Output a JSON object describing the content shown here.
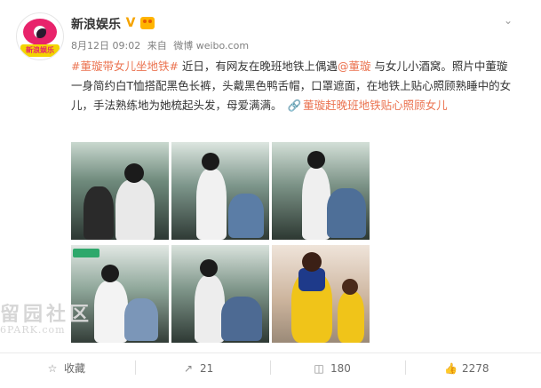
{
  "post": {
    "username": "新浪娱乐",
    "verified_glyph": "V",
    "avatar_text": "新浪娱乐",
    "date": "8月12日 09:02",
    "source_prefix": "来自",
    "source": "微博 weibo.com",
    "hashtag": "#董璇带女儿坐地铁#",
    "text_a": " 近日，有网友在晚班地铁上偶遇",
    "mention": "@董璇",
    "text_b": " 与女儿小酒窝。照片中董璇一身简约白T恤搭配黑色长裤，头戴黑色鸭舌帽，口罩遮面，在地铁上贴心照顾熟睡中的女儿，手法熟练地为她梳起头发，母爱满满。",
    "link_text": "董璇赶晚班地铁贴心照顾女儿",
    "icons": {
      "more": "chevron-down-icon",
      "link": "link-icon",
      "favorite": "star-icon",
      "repost": "repost-icon",
      "comment": "comment-icon",
      "like": "thumbs-up-icon"
    }
  },
  "watermark": {
    "big": "留园社区",
    "small": "6PARK.com"
  },
  "actions": {
    "favorite": "收藏",
    "repost_count": "21",
    "comment_count": "180",
    "like_count": "2278"
  },
  "colors": {
    "link": "#eb7350",
    "brand_pink": "#e8236b",
    "verified": "#f5a300"
  }
}
